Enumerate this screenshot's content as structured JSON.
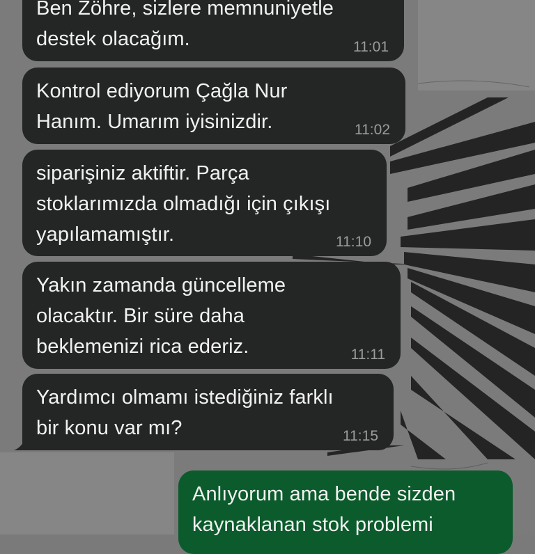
{
  "colors": {
    "incoming_bubble": "#242626",
    "outgoing_bubble": "#0c5b2c",
    "message_text": "#f1f1f1",
    "timestamp": "#9b9c9c",
    "wallpaper": "#7a7a7a"
  },
  "messages": [
    {
      "direction": "incoming",
      "text": "Ben Zöhre, sizlere memnuniyetle\ndestek olacağım.",
      "time": "11:01"
    },
    {
      "direction": "incoming",
      "text": "Kontrol ediyorum Çağla Nur\nHanım. Umarım iyisinizdir.",
      "time": "11:02"
    },
    {
      "direction": "incoming",
      "text": "siparişiniz aktiftir. Parça\nstoklarımızda olmadığı için çıkışı\nyapılamamıştır.",
      "time": "11:10"
    },
    {
      "direction": "incoming",
      "text": "Yakın zamanda güncelleme\nolacaktır. Bir süre daha\nbeklemenizi rica ederiz.",
      "time": "11:11"
    },
    {
      "direction": "incoming",
      "text": "Yardımcı olmamı istediğiniz farklı\nbir konu var mı?",
      "time": "11:15"
    },
    {
      "direction": "outgoing",
      "text": "Anlıyorum ama bende sizden\nkaynaklanan stok problemi",
      "time": ""
    }
  ]
}
